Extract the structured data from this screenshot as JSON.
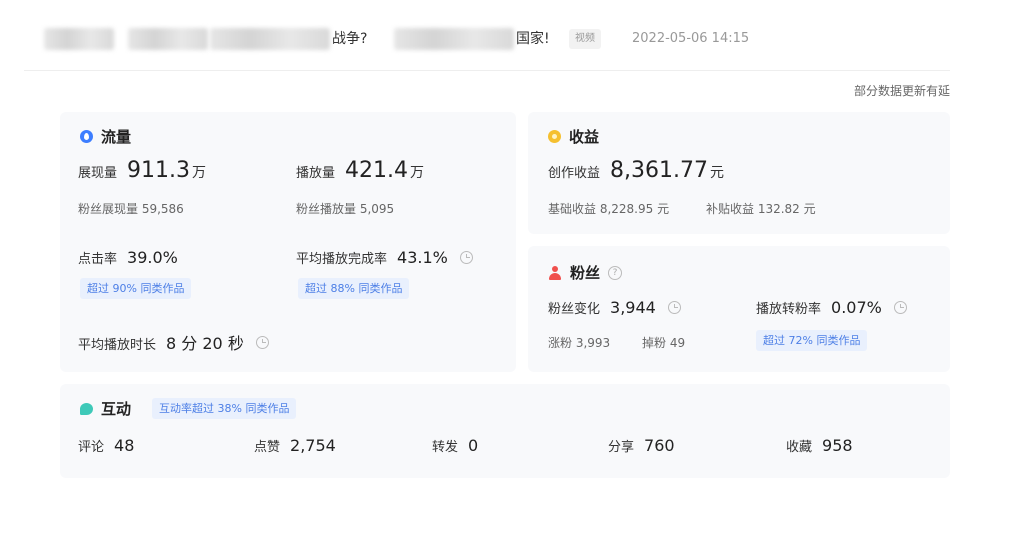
{
  "header": {
    "title_fragment_1": "战争?",
    "title_fragment_2": "国家!",
    "tag": "视频",
    "date": "2022-05-06 14:15"
  },
  "note": "部分数据更新有延",
  "flow": {
    "title": "流量",
    "impressions": {
      "label": "展现量",
      "value": "911.3",
      "unit": "万"
    },
    "fan_impressions": "粉丝展现量 59,586",
    "plays": {
      "label": "播放量",
      "value": "421.4",
      "unit": "万"
    },
    "fan_plays": "粉丝播放量 5,095",
    "ctr": {
      "label": "点击率",
      "value": "39.0%",
      "badge": "超过 90% 同类作品"
    },
    "completion": {
      "label": "平均播放完成率",
      "value": "43.1%",
      "badge": "超过 88% 同类作品"
    },
    "avg_duration": {
      "label": "平均播放时长",
      "value": "8 分 20 秒"
    }
  },
  "income": {
    "title": "收益",
    "creation": {
      "label": "创作收益",
      "value": "8,361.77",
      "unit": "元"
    },
    "basic": "基础收益 8,228.95 元",
    "subsidy": "补贴收益 132.82 元"
  },
  "fans": {
    "title": "粉丝",
    "change": {
      "label": "粉丝变化",
      "value": "3,944"
    },
    "gain": "涨粉 3,993",
    "loss": "掉粉 49",
    "conversion": {
      "label": "播放转粉率",
      "value": "0.07%",
      "badge": "超过 72% 同类作品"
    }
  },
  "interaction": {
    "title": "互动",
    "badge": "互动率超过 38% 同类作品",
    "items": [
      {
        "label": "评论",
        "value": "48"
      },
      {
        "label": "点赞",
        "value": "2,754"
      },
      {
        "label": "转发",
        "value": "0"
      },
      {
        "label": "分享",
        "value": "760"
      },
      {
        "label": "收藏",
        "value": "958"
      }
    ]
  }
}
